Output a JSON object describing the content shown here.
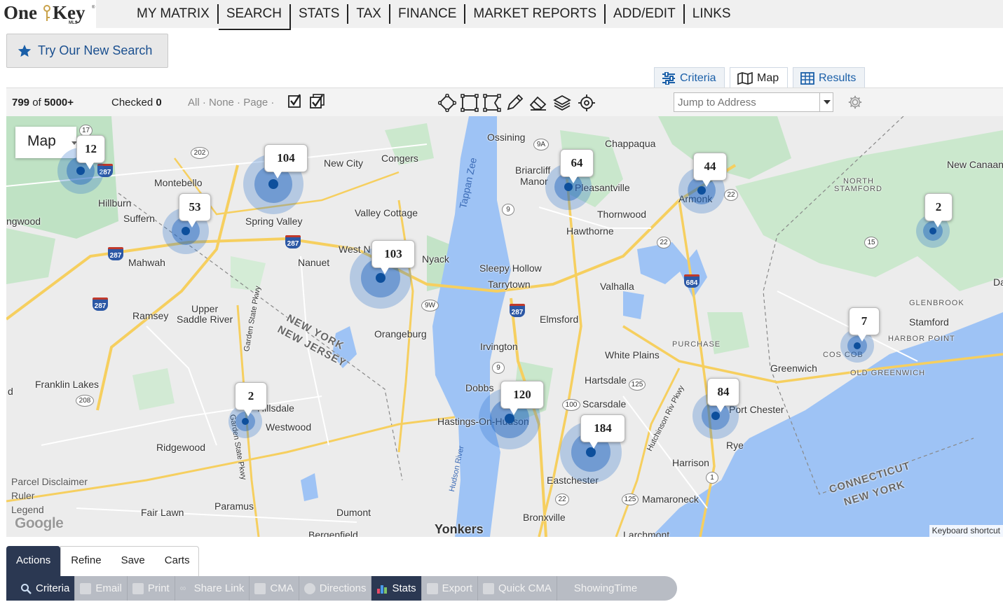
{
  "logo": {
    "one": "One",
    "key": "Key",
    "mls": "MLS",
    "tm": "®"
  },
  "nav": {
    "items": [
      {
        "label": "MY MATRIX"
      },
      {
        "label": "SEARCH"
      },
      {
        "label": "STATS"
      },
      {
        "label": "TAX"
      },
      {
        "label": "FINANCE"
      },
      {
        "label": "MARKET REPORTS"
      },
      {
        "label": "ADD/EDIT"
      },
      {
        "label": "LINKS"
      }
    ],
    "active": "SEARCH"
  },
  "try_search": {
    "label": "Try Our New Search",
    "icon": "star-icon"
  },
  "view_tabs": [
    {
      "label": "Criteria",
      "icon": "sliders-icon"
    },
    {
      "label": "Map",
      "icon": "map-icon",
      "active": true
    },
    {
      "label": "Results",
      "icon": "grid-icon"
    }
  ],
  "toolbar": {
    "count": "799",
    "of": "of",
    "total": "5000+",
    "checked_label": "Checked",
    "checked_value": "0",
    "select_all": "All",
    "select_none": "None",
    "select_page": "Page",
    "jump_placeholder": "Jump to Address",
    "draw_icons": [
      "polygon-icon",
      "rectangle-icon",
      "freeform-icon",
      "pencil-icon",
      "eraser-icon",
      "layers-icon",
      "locate-icon"
    ]
  },
  "map": {
    "type_label": "Map",
    "places": [
      {
        "text": "Ossining"
      },
      {
        "text": "Chappaqua"
      },
      {
        "text": "New City"
      },
      {
        "text": "Congers"
      },
      {
        "text": "Briarcliff"
      },
      {
        "text": "Manor"
      },
      {
        "text": "Pleasantville"
      },
      {
        "text": "Montebello"
      },
      {
        "text": "Hillburn"
      },
      {
        "text": "Suffern"
      },
      {
        "text": "ngwood"
      },
      {
        "text": "Spring Valley"
      },
      {
        "text": "Valley Cottage"
      },
      {
        "text": "Thornwood"
      },
      {
        "text": "Hawthorne"
      },
      {
        "text": "Armonk"
      },
      {
        "text": "New Canaan"
      },
      {
        "text": "NORTH"
      },
      {
        "text": "STAMFORD"
      },
      {
        "text": "Mahwah"
      },
      {
        "text": "Nanuet"
      },
      {
        "text": "West N"
      },
      {
        "text": "Nyack"
      },
      {
        "text": "Sleepy Hollow"
      },
      {
        "text": "Tarrytown"
      },
      {
        "text": "Valhalla"
      },
      {
        "text": "Ramsey"
      },
      {
        "text": "Upper"
      },
      {
        "text": "Saddle River"
      },
      {
        "text": "Orangeburg"
      },
      {
        "text": "Elmsford"
      },
      {
        "text": "GLENBROOK"
      },
      {
        "text": "Stamford"
      },
      {
        "text": "HARBOR POINT"
      },
      {
        "text": "PURCHASE"
      },
      {
        "text": "Irvington"
      },
      {
        "text": "White Plains"
      },
      {
        "text": "COS COB"
      },
      {
        "text": "Greenwich"
      },
      {
        "text": "OLD GREENWICH"
      },
      {
        "text": "Franklin Lakes"
      },
      {
        "text": "Hartsdale"
      },
      {
        "text": "Dobbs"
      },
      {
        "text": "Scarsdale"
      },
      {
        "text": "Port Chester"
      },
      {
        "text": "Hillsdale"
      },
      {
        "text": "Westwood"
      },
      {
        "text": "Hastings-On-Hudson"
      },
      {
        "text": "Ridgewood"
      },
      {
        "text": "Rye"
      },
      {
        "text": "Harrison"
      },
      {
        "text": "Eastchester"
      },
      {
        "text": "Paramus"
      },
      {
        "text": "Mamaroneck"
      },
      {
        "text": "Fair Lawn"
      },
      {
        "text": "Dumont"
      },
      {
        "text": "Bronxville"
      },
      {
        "text": "Yonkers"
      },
      {
        "text": "Bergenfield"
      },
      {
        "text": "Larchmont"
      },
      {
        "text": "Da"
      },
      {
        "text": "d"
      }
    ],
    "water": [
      {
        "text": "Tappan Zee"
      },
      {
        "text": "Hudson River"
      }
    ],
    "states": [
      {
        "text": "NEW YORK"
      },
      {
        "text": "NEW JERSEY"
      },
      {
        "text": "CONNECTICUT"
      },
      {
        "text": "NEW YORK"
      }
    ],
    "roads": [
      {
        "text": "Garden State Pkwy"
      },
      {
        "text": "Garden State Pkwy"
      },
      {
        "text": "Hutchinson Riv Pkwy"
      }
    ],
    "shields": [
      "17",
      "202",
      "9A",
      "9",
      "22",
      "15",
      "22",
      "9W",
      "9",
      "125",
      "100",
      "208",
      "22",
      "125",
      "1",
      "287",
      "287",
      "287",
      "287",
      "287",
      "684"
    ],
    "clusters": [
      {
        "count": "12"
      },
      {
        "count": "104"
      },
      {
        "count": "64"
      },
      {
        "count": "44"
      },
      {
        "count": "2"
      },
      {
        "count": "53"
      },
      {
        "count": "103"
      },
      {
        "count": "7"
      },
      {
        "count": "84"
      },
      {
        "count": "2"
      },
      {
        "count": "120"
      },
      {
        "count": "184"
      }
    ],
    "links": [
      "Parcel Disclaimer",
      "Ruler",
      "Legend"
    ],
    "google": "Google",
    "keyboard": "Keyboard shortcut"
  },
  "bottom_tabs": [
    {
      "label": "Actions",
      "active": true
    },
    {
      "label": "Refine"
    },
    {
      "label": "Save"
    },
    {
      "label": "Carts"
    }
  ],
  "actions": [
    {
      "label": "Criteria",
      "icon": "search-icon",
      "on": true
    },
    {
      "label": "Email",
      "icon": "email-icon"
    },
    {
      "label": "Print",
      "icon": "print-icon"
    },
    {
      "label": "Share Link",
      "icon": "link-icon"
    },
    {
      "label": "CMA",
      "icon": "cma-icon"
    },
    {
      "label": "Directions",
      "icon": "directions-icon"
    },
    {
      "label": "Stats",
      "icon": "bar-chart-icon",
      "on": true
    },
    {
      "label": "Export",
      "icon": "export-icon"
    },
    {
      "label": "Quick CMA",
      "icon": "quick-cma-icon"
    },
    {
      "label": "ShowingTime",
      "icon": ""
    }
  ],
  "colors": {
    "nav_bg": "#f0f0f0",
    "link_blue": "#1a5fa8",
    "cluster_blue": "#1a66c4",
    "action_dark": "#2b3852",
    "water": "#9ec3f5",
    "road": "#f9d26a",
    "park": "#bde3c1"
  }
}
